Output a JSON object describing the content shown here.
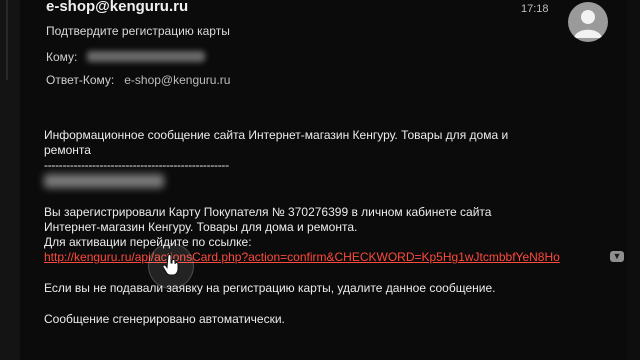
{
  "email": {
    "sender": "e-shop@kenguru.ru",
    "time": "17:18",
    "subject": "Подтвердите регистрацию карты",
    "to_label": "Кому:",
    "reply_to_label": "Ответ-Кому:",
    "reply_to_value": "e-shop@kenguru.ru"
  },
  "body": {
    "intro_line1": "Информационное сообщение сайта Интернет-магазин Кенгуру. Товары для дома и",
    "intro_line2": "ремонта",
    "separator": "--------------------------------------------------",
    "reg_line1": "Вы зарегистрировали Карту Покупателя  № 370276399 в личном кабинете сайта",
    "reg_line2": "Интернет-магазин Кенгуру. Товары для дома и ремонта.",
    "activate_label": "Для активации перейдите по ссылке:",
    "link_text": "http://kenguru.ru/api/actionsCard.php?action=confirm&CHECKWORD=Kp5Hg1wJtcmbbfYeN8Ho",
    "ignore_line": "Если вы не подавали заявку на регистрацию карты, удалите данное сообщение.",
    "auto_line": "Сообщение сгенерировано автоматически."
  },
  "colors": {
    "background": "#0b0b0b",
    "link": "#ff4a3c"
  },
  "icons": {
    "avatar": "person-avatar-icon",
    "expand": "chevron-down-icon",
    "cursor": "hand-pointer-icon"
  }
}
